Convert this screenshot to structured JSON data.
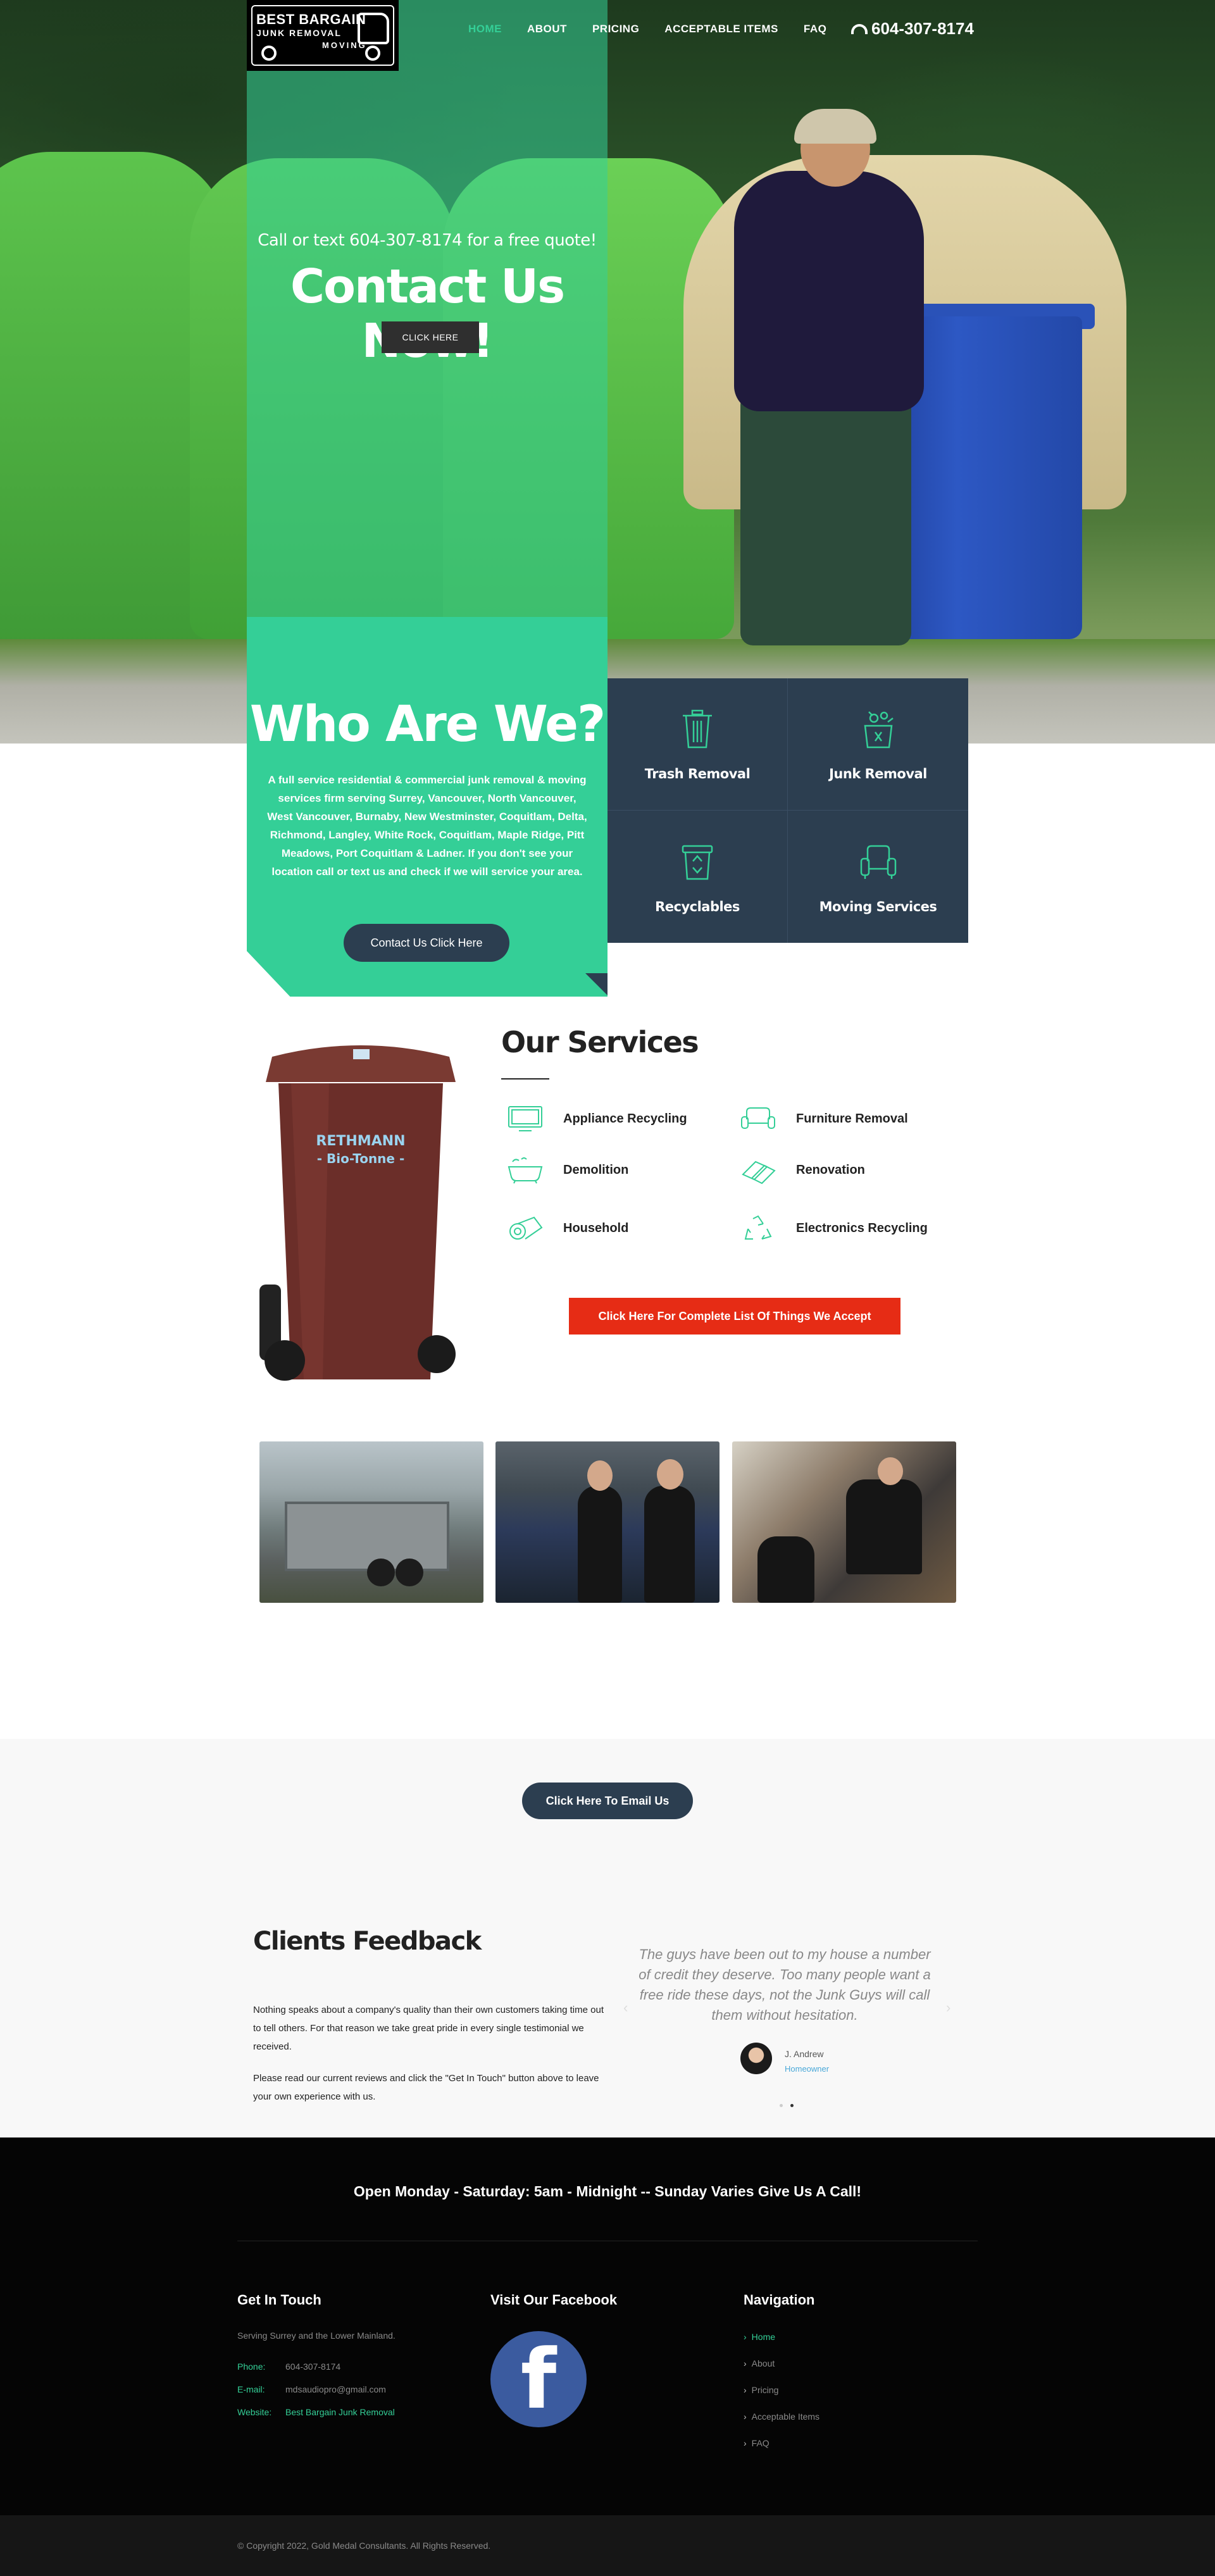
{
  "header": {
    "logo": {
      "line1": "BEST BARGAIN",
      "line2": "JUNK REMOVAL",
      "line3": "MOVING"
    },
    "nav": [
      "HOME",
      "ABOUT",
      "PRICING",
      "ACCEPTABLE ITEMS",
      "FAQ"
    ],
    "phone": "604-307-8174"
  },
  "hero": {
    "subtitle": "Call or text 604-307-8174 for a free quote!",
    "title": "Contact Us Now!",
    "button": "CLICK HERE"
  },
  "who": {
    "title": "Who Are We?",
    "text": "A full service residential & commercial junk removal & moving services firm serving Surrey, Vancouver, North Vancouver, West Vancouver, Burnaby, New Westminster, Coquitlam, Delta, Richmond, Langley, White Rock, Coquitlam, Maple Ridge, Pitt Meadows, Port Coquitlam & Ladner. If you don't see your location call or text us and check if we will service your area.",
    "button": "Contact Us Click Here"
  },
  "service_tiles": [
    {
      "label": "Trash Removal",
      "icon": "trash-can-icon"
    },
    {
      "label": "Junk Removal",
      "icon": "junk-pile-icon"
    },
    {
      "label": "Recyclables",
      "icon": "recycle-bin-icon"
    },
    {
      "label": "Moving Services",
      "icon": "armchair-icon"
    }
  ],
  "services": {
    "title": "Our Services",
    "items": [
      {
        "label": "Appliance Recycling",
        "icon": "monitor-icon"
      },
      {
        "label": "Furniture Removal",
        "icon": "sofa-icon"
      },
      {
        "label": "Demolition",
        "icon": "bathtub-icon"
      },
      {
        "label": "Renovation",
        "icon": "tiles-icon"
      },
      {
        "label": "Household",
        "icon": "rolled-carpet-icon"
      },
      {
        "label": "Electronics Recycling",
        "icon": "recycling-icon"
      }
    ],
    "button": "Click Here For Complete List Of Things We Accept",
    "bin_text": [
      "RETHMANN",
      "- Bio-Tonne -"
    ]
  },
  "email": {
    "button": "Click Here To Email Us"
  },
  "feedback": {
    "title": "Clients Feedback",
    "p1": "Nothing speaks about a company's quality than their own customers taking time out to tell others. For that reason we take great pride in every single testimonial we received.",
    "p2": "Please read our current reviews and click the \"Get In Touch\" button above to leave your own experience with us.",
    "quote": "The guys have been out to my house a number of credit they deserve. Too many people want a free ride these days, not the Junk Guys will call them without hesitation.",
    "author": "J. Andrew",
    "role": "Homeowner"
  },
  "footer": {
    "hours": "Open Monday - Saturday: 5am - Midnight -- Sunday Varies Give Us A Call!",
    "touch": {
      "title": "Get In Touch",
      "area": "Serving Surrey and the Lower Mainland.",
      "phone_key": "Phone:",
      "phone": "604-307-8174",
      "email_key": "E-mail:",
      "email": "mdsaudiopro@gmail.com",
      "website_key": "Website:",
      "website": "Best Bargain Junk Removal"
    },
    "facebook_title": "Visit Our Facebook",
    "facebook_letter": "f",
    "nav_title": "Navigation",
    "nav": [
      "Home",
      "About",
      "Pricing",
      "Acceptable Items",
      "FAQ"
    ],
    "copyright": "© Copyright 2022, Gold Medal Consultants. All Rights Reserved."
  },
  "colors": {
    "accent": "#34cf97",
    "dark": "#2c3e50",
    "red": "#e62c15"
  }
}
